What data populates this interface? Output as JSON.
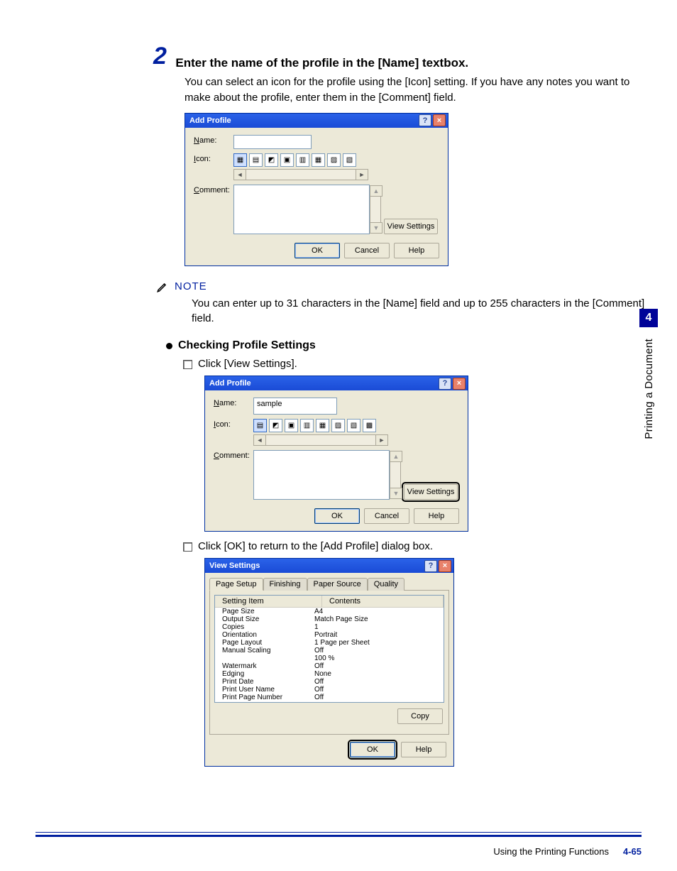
{
  "step": {
    "number": "2",
    "title": "Enter the name of the profile in the [Name] textbox.",
    "body": "You can select an icon for the profile using the [Icon] setting. If you have any notes you want to make about the profile, enter them in the [Comment] field."
  },
  "note": {
    "label": "NOTE",
    "text": "You can enter up to 31 characters in the [Name] field and up to 255 characters in the [Comment] field."
  },
  "section": {
    "heading": "Checking Profile Settings",
    "step1": "Click [View Settings].",
    "step2": "Click [OK] to return to the [Add Profile] dialog box."
  },
  "dialog": {
    "title": "Add Profile",
    "labels": {
      "name": "Name:",
      "icon": "Icon:",
      "comment": "Comment:"
    },
    "name_value_sample": "sample",
    "buttons": {
      "view_settings": "View Settings",
      "ok": "OK",
      "cancel": "Cancel",
      "help": "Help"
    }
  },
  "view_settings": {
    "title": "View Settings",
    "tabs": [
      "Page Setup",
      "Finishing",
      "Paper Source",
      "Quality"
    ],
    "columns": {
      "item": "Setting Item",
      "contents": "Contents"
    },
    "rows": [
      {
        "item": "Page Size",
        "value": "A4"
      },
      {
        "item": "Output Size",
        "value": "Match Page Size"
      },
      {
        "item": "Copies",
        "value": "1"
      },
      {
        "item": "Orientation",
        "value": "Portrait"
      },
      {
        "item": "Page Layout",
        "value": "1 Page per Sheet"
      },
      {
        "item": "Manual Scaling",
        "value": "Off"
      },
      {
        "item": "",
        "value": "100 %"
      },
      {
        "item": "Watermark",
        "value": "Off"
      },
      {
        "item": "Edging",
        "value": "None"
      },
      {
        "item": "Print Date",
        "value": "Off"
      },
      {
        "item": "Print User Name",
        "value": "Off"
      },
      {
        "item": "Print Page Number",
        "value": "Off"
      }
    ],
    "buttons": {
      "copy": "Copy",
      "ok": "OK",
      "help": "Help"
    }
  },
  "sidebar": {
    "chapter": "4",
    "section_title": "Printing a Document"
  },
  "footer": {
    "section": "Using the Printing Functions",
    "page": "4-65"
  }
}
